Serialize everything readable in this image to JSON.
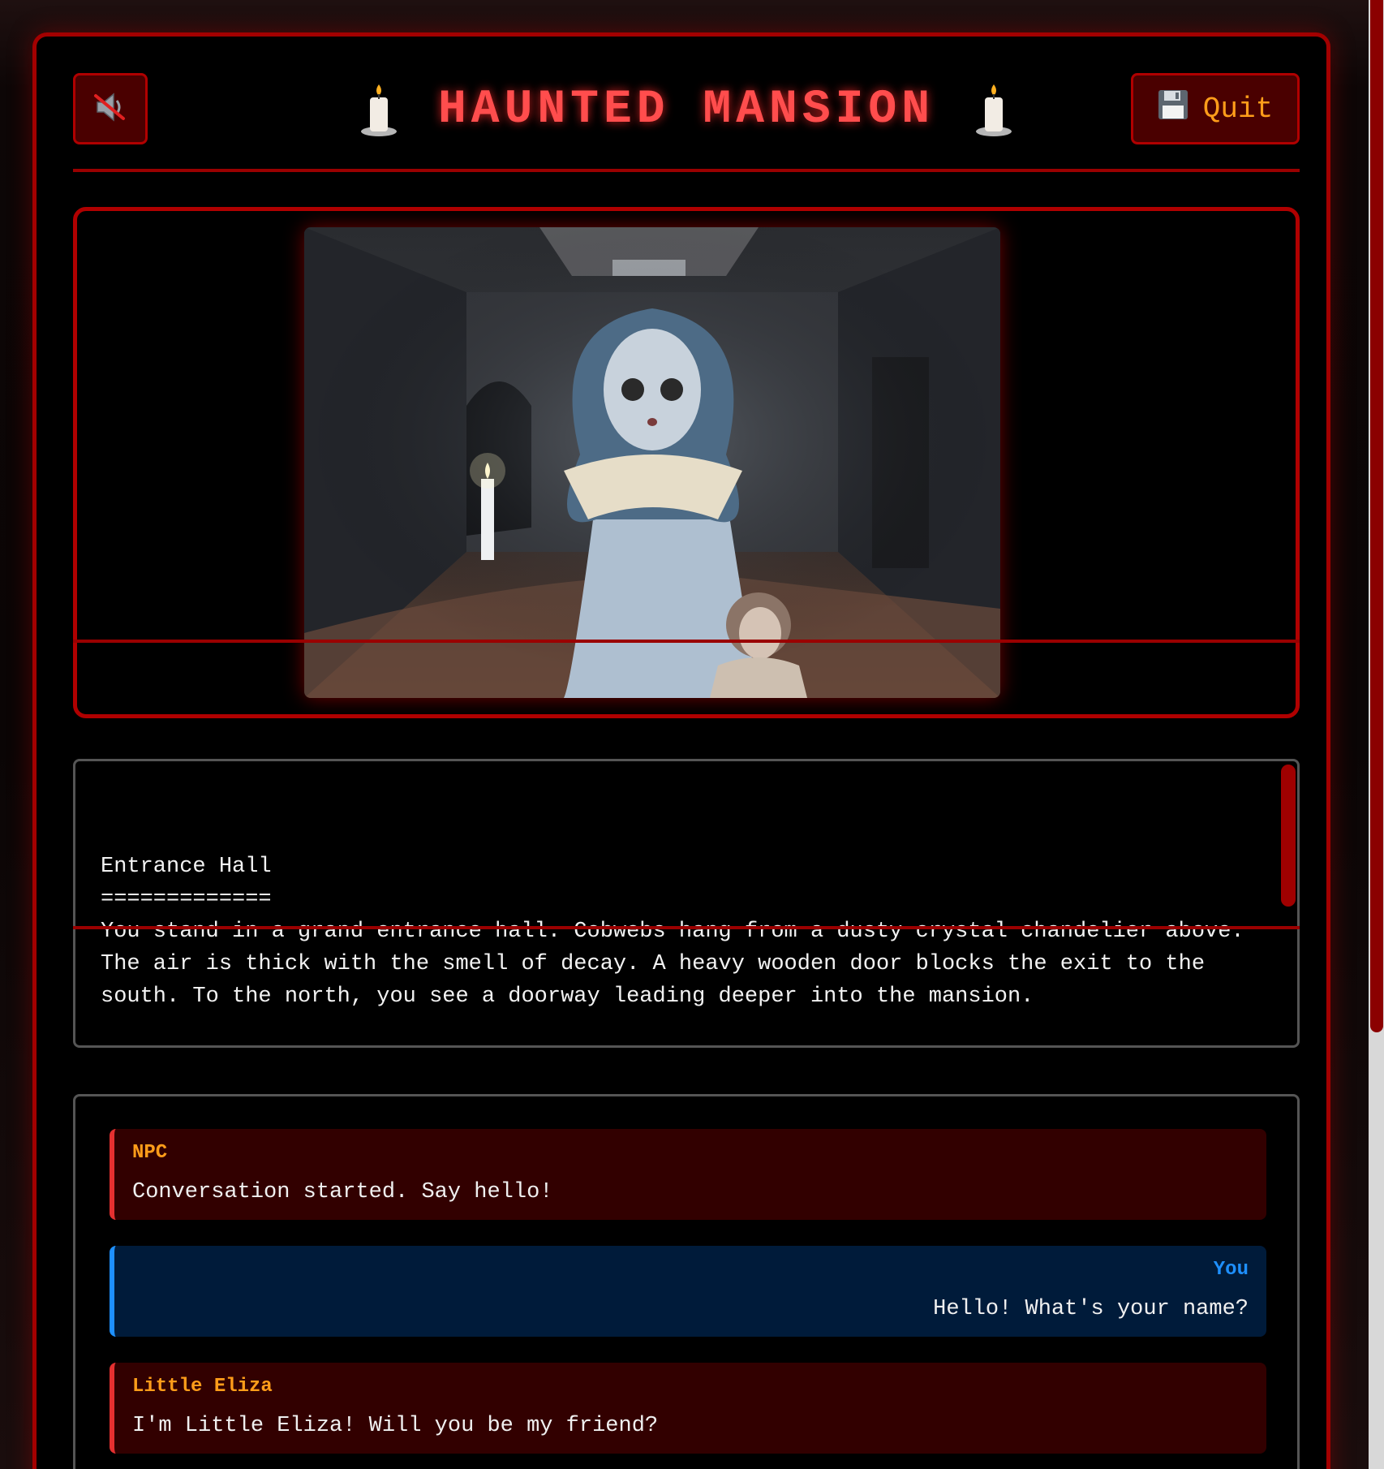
{
  "header": {
    "sound_icon": "muted-speaker-icon",
    "title": "HAUNTED MANSION",
    "candle_icon": "candle-icon",
    "quit_icon": "floppy-disk-icon",
    "quit_label": "Quit"
  },
  "scene": {
    "image_icon": "ghost-girl-scene-image"
  },
  "room": {
    "name": "Entrance Hall",
    "underline": "=============",
    "description": "You stand in a grand entrance hall. Cobwebs hang from a dusty crystal chandelier above. The air is thick with the smell of decay. A heavy wooden door blocks the exit to the south. To the north, you see a doorway leading deeper into the mansion."
  },
  "chat": {
    "messages": [
      {
        "speaker": "NPC",
        "text": "Conversation started. Say hello!",
        "kind": "npc"
      },
      {
        "speaker": "You",
        "text": "Hello! What's your name?",
        "kind": "you"
      },
      {
        "speaker": "Little Eliza",
        "text": "I'm Little Eliza! Will you be my friend?",
        "kind": "npc"
      }
    ]
  },
  "colors": {
    "accent_red": "#b00000",
    "title_red": "#ff4d4d",
    "npc_name": "#ff9d1a",
    "player_blue": "#1e90ff"
  }
}
